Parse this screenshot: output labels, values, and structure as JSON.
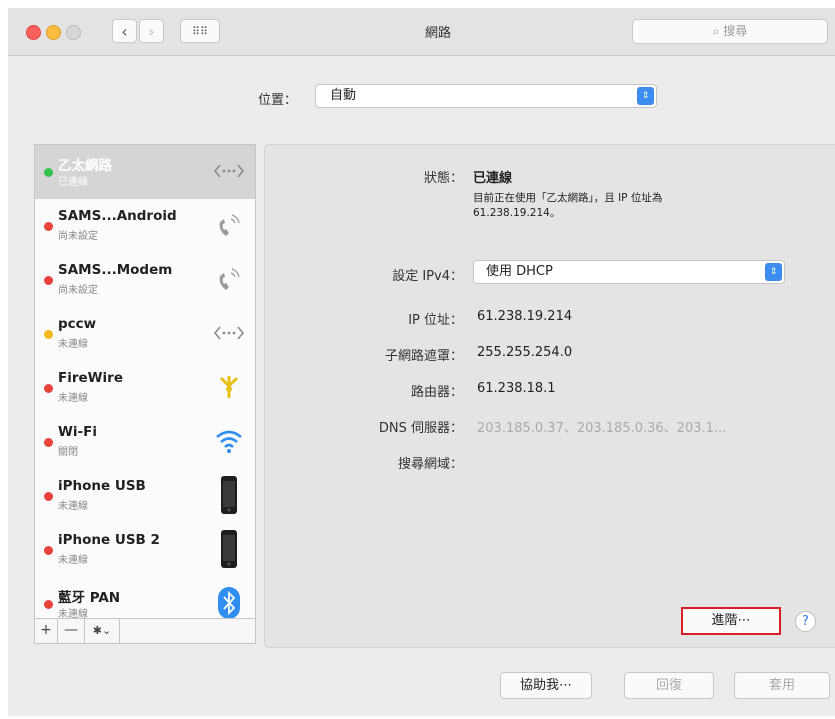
{
  "window": {
    "title": "網路"
  },
  "toolbar": {
    "back_label": "‹",
    "forward_label": "›",
    "grid_label": "⠿⠿",
    "search_placeholder": "搜尋"
  },
  "location": {
    "label": "位置：",
    "value": "自動"
  },
  "sidebar": {
    "items": [
      {
        "name": "乙太網路",
        "status": "已連線",
        "dot": "#35c24a",
        "icon": "ethernet-icon",
        "selected": true
      },
      {
        "name": "SAMS...Android",
        "status": "尚未設定",
        "dot": "#e8433b",
        "icon": "phone-icon"
      },
      {
        "name": "SAMS...Modem",
        "status": "尚未設定",
        "dot": "#e8433b",
        "icon": "phone-icon"
      },
      {
        "name": "pccw",
        "status": "未連線",
        "dot": "#f2b81e",
        "icon": "vpn-icon"
      },
      {
        "name": "FireWire",
        "status": "未連線",
        "dot": "#e8433b",
        "icon": "firewire-icon"
      },
      {
        "name": "Wi-Fi",
        "status": "關閉",
        "dot": "#e8433b",
        "icon": "wifi-icon"
      },
      {
        "name": "iPhone USB",
        "status": "未連線",
        "dot": "#e8433b",
        "icon": "iphone-icon"
      },
      {
        "name": "iPhone USB 2",
        "status": "未連線",
        "dot": "#e8433b",
        "icon": "iphone-icon"
      },
      {
        "name": "藍牙 PAN",
        "status": "未連線",
        "dot": "#e8433b",
        "icon": "bluetooth-icon"
      }
    ],
    "add_label": "+",
    "remove_label": "—",
    "action_label": "✱⌄"
  },
  "detail": {
    "status_label": "狀態：",
    "status_value": "已連線",
    "status_desc_1": "目前正在使用「乙太網路」，且 IP 位址為",
    "status_desc_2": "61.238.19.214。",
    "ipv4_label": "設定 IPv4：",
    "ipv4_value": "使用 DHCP",
    "ip_label": "IP 位址：",
    "ip_value": "61.238.19.214",
    "subnet_label": "子網路遮罩：",
    "subnet_value": "255.255.254.0",
    "router_label": "路由器：",
    "router_value": "61.238.18.1",
    "dns_label": "DNS 伺服器：",
    "dns_value": "203.185.0.37、203.185.0.36、203.1...",
    "search_domain_label": "搜尋網域：",
    "advanced_label": "進階⋯",
    "help_label": "?"
  },
  "footer": {
    "assist_label": "協助我⋯",
    "revert_label": "回復",
    "apply_label": "套用"
  },
  "colors": {
    "accent": "#3b8ef0",
    "highlight_border": "#d52027"
  }
}
